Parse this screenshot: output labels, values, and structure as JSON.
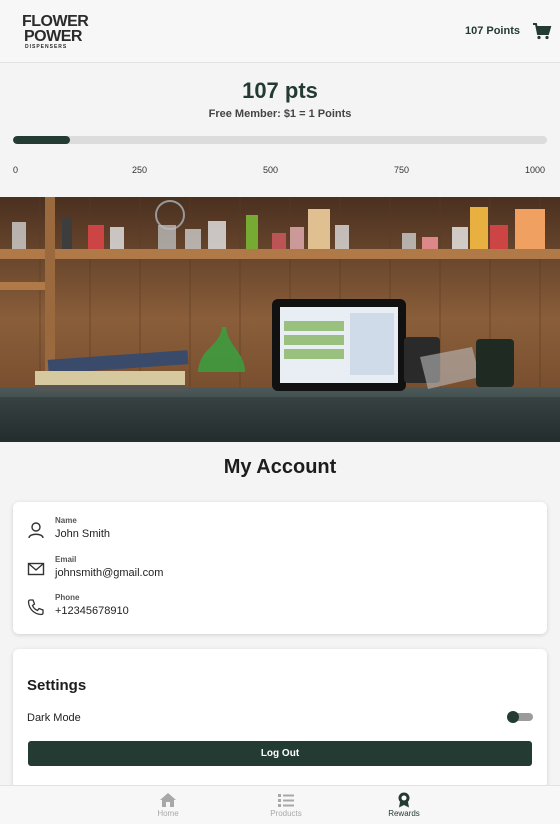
{
  "header": {
    "logo_line1": "FLOWER",
    "logo_line2": "POWER",
    "logo_line3": "DISPENSERS",
    "points_label": "107 Points",
    "cart_icon": "cart-icon"
  },
  "rewards": {
    "points_display": "107 pts",
    "membership_text": "Free Member: $1 = 1 Points",
    "progress_fraction": 0.107,
    "ticks": [
      "0",
      "250",
      "500",
      "750",
      "1000"
    ]
  },
  "hero": {
    "image": "store-counter-photo"
  },
  "account": {
    "title": "My Account",
    "name_label": "Name",
    "name_value": "John Smith",
    "email_label": "Email",
    "email_value": "johnsmith@gmail.com",
    "phone_label": "Phone",
    "phone_value": "+12345678910"
  },
  "settings": {
    "title": "Settings",
    "dark_mode_label": "Dark Mode",
    "dark_mode_on": false,
    "logout_label": "Log Out"
  },
  "tabs": [
    {
      "label": "Home",
      "icon": "home-icon",
      "active": false
    },
    {
      "label": "Products",
      "icon": "list-icon",
      "active": false
    },
    {
      "label": "Rewards",
      "icon": "rewards-icon",
      "active": true
    }
  ],
  "colors": {
    "primary": "#243b33",
    "track": "#dcdcdc"
  }
}
